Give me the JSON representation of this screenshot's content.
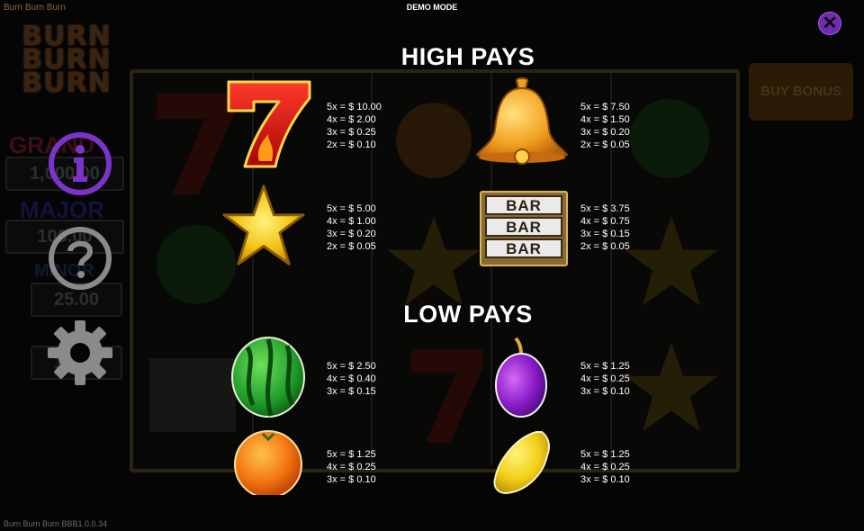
{
  "app": {
    "title": "Burn Burn Burn",
    "logo_text": [
      "BURN",
      "BURN",
      "BURN"
    ],
    "version": "Burn Burn Burn BBB1.0.0.34"
  },
  "header": {
    "demo_mode": "DEMO MODE"
  },
  "background": {
    "jackpots": [
      {
        "label": "GRAND",
        "value": "1,000.00"
      },
      {
        "label": "MAJOR",
        "value": "100.00"
      },
      {
        "label": "MINOR",
        "value": "25.00"
      },
      {
        "label": "",
        "value": "10.00"
      }
    ],
    "buy_bonus_label": "BUY BONUS"
  },
  "side_menu": {
    "info_icon": "info-icon",
    "help_icon": "help-icon",
    "settings_icon": "gear-icon"
  },
  "paytable": {
    "high_title": "HIGH PAYS",
    "low_title": "LOW PAYS",
    "high_symbols": [
      {
        "name": "seven",
        "pays": [
          "5x = $ 10.00",
          "4x = $ 2.00",
          "3x = $ 0.25",
          "2x = $ 0.10"
        ]
      },
      {
        "name": "bell",
        "pays": [
          "5x = $ 7.50",
          "4x = $ 1.50",
          "3x = $ 0.20",
          "2x = $ 0.05"
        ]
      },
      {
        "name": "star",
        "pays": [
          "5x = $ 5.00",
          "4x = $ 1.00",
          "3x = $ 0.20",
          "2x = $ 0.05"
        ]
      },
      {
        "name": "bar",
        "label": "BAR",
        "pays": [
          "5x = $ 3.75",
          "4x = $ 0.75",
          "3x = $ 0.15",
          "2x = $ 0.05"
        ]
      }
    ],
    "low_symbols": [
      {
        "name": "watermelon",
        "pays": [
          "5x = $ 2.50",
          "4x = $ 0.40",
          "3x = $ 0.15"
        ]
      },
      {
        "name": "plum",
        "pays": [
          "5x = $ 1.25",
          "4x = $ 0.25",
          "3x = $ 0.10"
        ]
      },
      {
        "name": "orange",
        "pays": [
          "5x = $ 1.25",
          "4x = $ 0.25",
          "3x = $ 0.10"
        ]
      },
      {
        "name": "lemon",
        "pays": [
          "5x = $ 1.25",
          "4x = $ 0.25",
          "3x = $ 0.10"
        ]
      }
    ]
  },
  "colors": {
    "accent_purple": "#6e2bb0",
    "seven_red": "#e01010",
    "gold": "#f2b21c",
    "overlay_bg": "#050505"
  }
}
